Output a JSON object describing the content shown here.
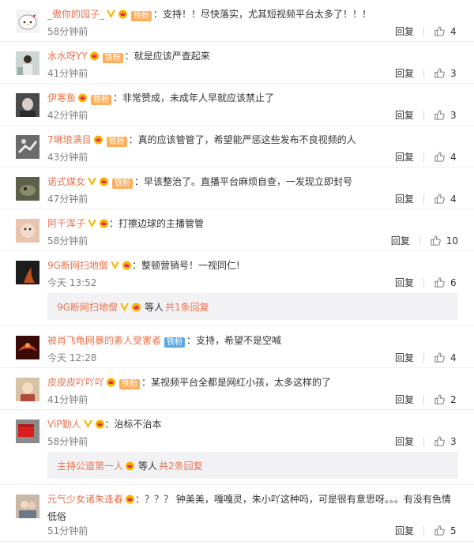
{
  "ui": {
    "reply_label": "回复"
  },
  "comments": [
    {
      "user": "_傲你的园子_",
      "fan": "铁粉",
      "text": "支持！！尽快落实，尤其短视频平台太多了！！！",
      "time": "58分钟前",
      "likes": "4"
    },
    {
      "user": "水水呀YY",
      "fan": "铁粉",
      "text": "就是应该严查起来",
      "time": "41分钟前",
      "likes": "3"
    },
    {
      "user": "伊寒鱼",
      "fan": "铁粉",
      "text": "非常赞成，未成年人早就应该禁止了",
      "time": "42分钟前",
      "likes": "3"
    },
    {
      "user": "7琳琅满目",
      "fan": "铁粉",
      "text": "真的应该管管了，希望能严惩这些发布不良视频的人",
      "time": "43分钟前",
      "likes": "4"
    },
    {
      "user": "诺式媒女",
      "fan": "铁粉",
      "text": "早该整治了。直播平台麻烦自查，一发现立即封号",
      "time": "47分钟前",
      "likes": "4"
    },
    {
      "user": "阿千浑子",
      "text": "打擦边球的主播管管",
      "time": "58分钟前",
      "likes": "10"
    },
    {
      "user": "9G断网扫地僧",
      "text": "整顿营销号！一视同仁!",
      "time": "今天 13:52",
      "likes": "6",
      "reply_summary": {
        "name": "9G断网扫地僧",
        "mid": "等人",
        "count": "共1条回复"
      }
    },
    {
      "user": "被肖飞龟网暴的素人受害者",
      "fan": "铁粉",
      "text": "支持，希望不是空喊",
      "time": "今天 12:28",
      "likes": "4"
    },
    {
      "user": "皮皮皮吖吖吖",
      "fan": "铁粉",
      "text": "某视频平台全都是网红小孩，太多这样的了",
      "time": "41分钟前",
      "likes": "2"
    },
    {
      "user": "ViP勤人",
      "text": "治标不治本",
      "time": "58分钟前",
      "likes": "3",
      "reply_summary": {
        "name": "主持公道第一人",
        "mid": "等人",
        "count": "共2条回复"
      }
    },
    {
      "user": "元气少女诸朱逢春",
      "text": "？？？ 钟美美，嘎嘎灵，朱小吖这种吗，可是很有意思呀。。。有没有色情低俗",
      "time": "51分钟前",
      "likes": "5"
    }
  ],
  "colors": {
    "username": "#eb7350",
    "fan_badge": "#ffae5a",
    "vip_badge": "#f7b500",
    "reply_bg": "#f2f2f5"
  }
}
